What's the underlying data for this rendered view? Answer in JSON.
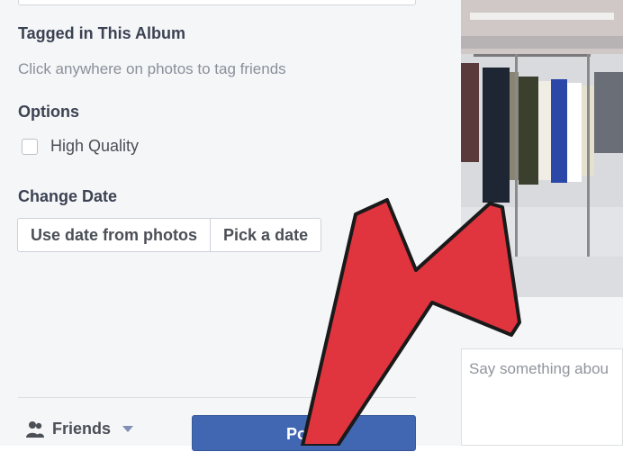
{
  "album": {
    "tagged_title": "Tagged in This Album",
    "tag_hint": "Click anywhere on photos to tag friends",
    "options_title": "Options",
    "high_quality_label": "High Quality",
    "change_date_title": "Change Date",
    "use_date_label": "Use date from photos",
    "pick_date_label": "Pick a date"
  },
  "footer": {
    "privacy_label": "Friends",
    "post_label": "Post"
  },
  "photo": {
    "caption_placeholder": "Say something abou"
  },
  "colors": {
    "accent": "#4267b2",
    "arrow": "#e0343e"
  },
  "icons": [
    "friends-icon",
    "caret-down-icon"
  ]
}
